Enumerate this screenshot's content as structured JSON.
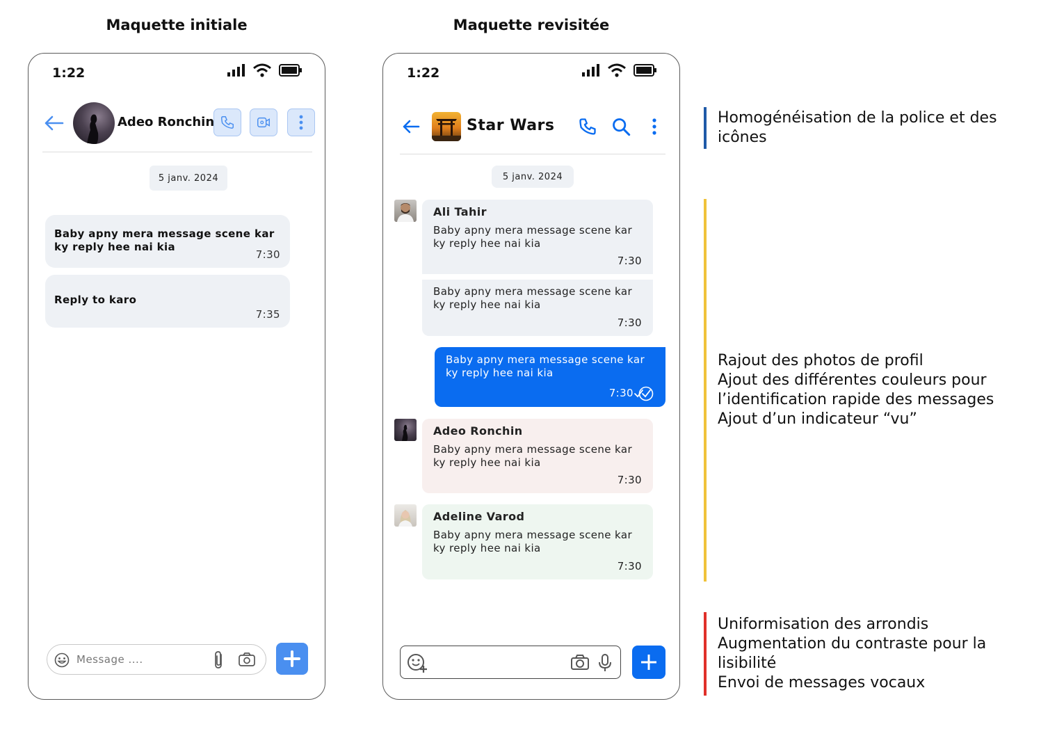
{
  "left": {
    "column_title": "Maquette initiale",
    "status_time": "1:22",
    "contact_name": "Adeo Ronchin",
    "date": "5 janv. 2024",
    "messages": [
      {
        "text": "Baby apny mera message scene kar\nky reply hee nai kia",
        "time": "7:30"
      },
      {
        "text": "Reply to karo",
        "time": "7:35"
      }
    ],
    "input_placeholder": "Message ...."
  },
  "right": {
    "column_title": "Maquette revisitée",
    "status_time": "1:22",
    "group_name": "Star Wars",
    "date": "5 janv. 2024",
    "msg1": {
      "sender": "Ali Tahir",
      "text": "Baby apny mera message scene kar\nky reply hee nai kia",
      "time": "7:30"
    },
    "msg2": {
      "text": "Baby apny mera message scene kar\nky reply hee nai kia",
      "time": "7:30"
    },
    "msg3": {
      "text": "Baby apny mera message scene kar\nky reply hee nai kia",
      "time": "7:30"
    },
    "msg4": {
      "sender": "Adeo Ronchin",
      "text": "Baby apny mera message scene kar\nky reply hee nai kia",
      "time": "7:30"
    },
    "msg5": {
      "sender": "Adeline Varod",
      "text": "Baby apny mera message scene kar\nky reply hee nai kia",
      "time": "7:30"
    }
  },
  "notes": {
    "note1": "Homogénéisation de la police et des\nicônes",
    "note2": "Rajout des photos de profil\nAjout des différentes couleurs pour\nl’identification rapide des messages\nAjout d’un indicateur “vu”",
    "note3": "Uniformisation des arrondis\nAugmentation du contraste pour la\nlisibilité\nEnvoi de messages vocaux"
  },
  "colors": {
    "accent_blue": "#0a6cf0",
    "light_blue": "#4a8ff0",
    "bubble_grey": "#eef1f5",
    "bubble_pink": "#f8efee",
    "bubble_green": "#eef6f0",
    "bar_blue": "#1f5aa8",
    "bar_yellow": "#f0c23a",
    "bar_red": "#e0302a"
  }
}
